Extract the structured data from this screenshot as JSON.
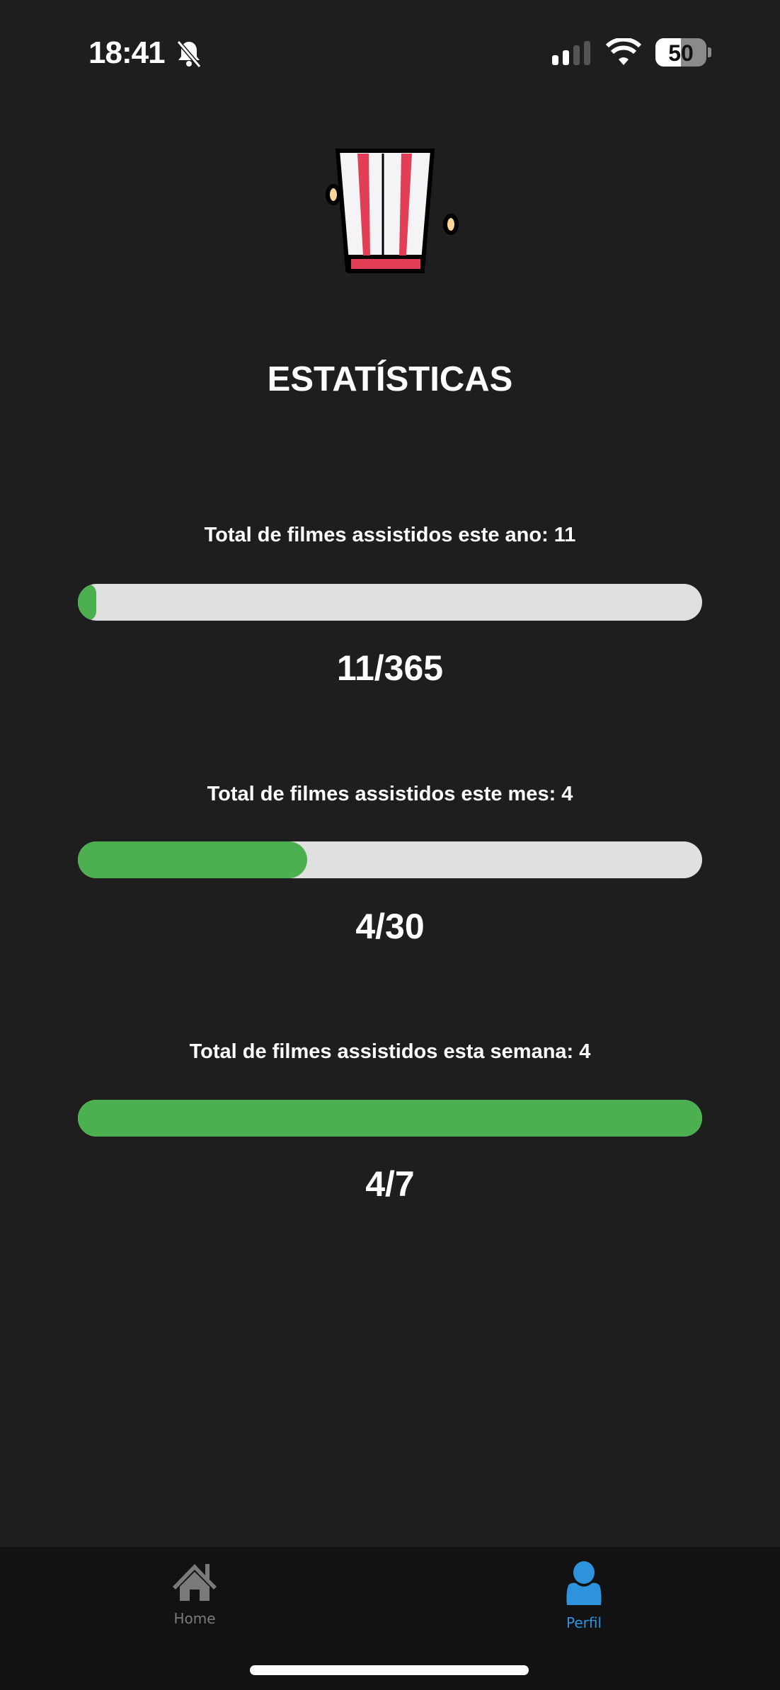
{
  "status_bar": {
    "time": "18:41",
    "battery": "50",
    "icons": [
      "bell-slash-icon",
      "signal-icon",
      "wifi-icon",
      "battery-icon"
    ]
  },
  "header": {
    "logo": "popcorn-icon",
    "title": "ESTATÍSTICAS"
  },
  "stats": [
    {
      "label": "Total de filmes assistidos este ano: 11",
      "fraction": "11/365",
      "progress": 0.03
    },
    {
      "label": "Total de filmes assistidos este mes: 4",
      "fraction": "4/30",
      "progress": 0.367
    },
    {
      "label": "Total de filmes assistidos esta semana: 4",
      "fraction": "4/7",
      "progress": 1.0
    }
  ],
  "colors": {
    "background": "#1e1e1e",
    "progress_fill": "#4caf50",
    "progress_track": "#e0e0e0",
    "tab_active": "#2d93dc",
    "tab_inactive": "#7a7a7a"
  },
  "tabbar": {
    "tabs": [
      {
        "label": "Home",
        "icon": "home-icon",
        "active": false
      },
      {
        "label": "Perfil",
        "icon": "person-icon",
        "active": true
      }
    ]
  }
}
